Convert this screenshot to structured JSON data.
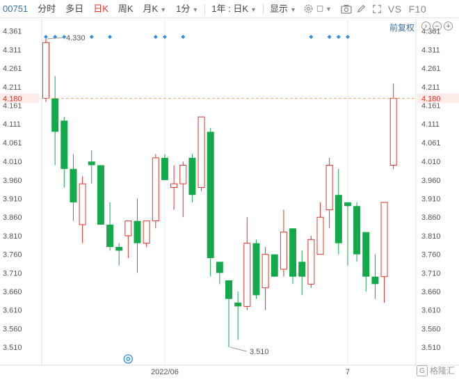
{
  "toolbar": {
    "code": "00751",
    "intraday": "分时",
    "multiday": "多日",
    "daily": "日K",
    "weekly": "周K",
    "monthly": "月K",
    "minute": "1分",
    "range": "1年 : 日K",
    "display": "显示",
    "vs": "VS",
    "f10": "F10"
  },
  "adjust_label": "前复权",
  "watermark": "格隆汇",
  "colors": {
    "up": "#e4322b",
    "down": "#14a94b",
    "up_fill": "#ffffff",
    "price_line": "#e8a66a",
    "price_tag": "#e4322b"
  },
  "chart_data": {
    "type": "candlestick",
    "y_ticks": [
      "4.361",
      "4.311",
      "4.261",
      "4.211",
      "4.161",
      "4.111",
      "4.061",
      "4.010",
      "3.960",
      "3.910",
      "3.860",
      "3.810",
      "3.760",
      "3.710",
      "3.660",
      "3.610",
      "3.560",
      "3.510"
    ],
    "ylim": [
      3.485,
      4.382
    ],
    "x_labels": [
      {
        "index": 13,
        "label": "2022/06"
      },
      {
        "index": 33,
        "label": "7"
      }
    ],
    "current_price": "4.180",
    "max_label": "4.330",
    "max_index": 0,
    "min_label": "3.510",
    "min_index": 18,
    "marker_indices": [
      0,
      1,
      2,
      5,
      7,
      12,
      13,
      15,
      29,
      31,
      32,
      33
    ],
    "candles": [
      {
        "o": 4.18,
        "h": 4.34,
        "l": 4.17,
        "c": 4.33
      },
      {
        "o": 4.18,
        "h": 4.24,
        "l": 4.0,
        "c": 4.09
      },
      {
        "o": 4.12,
        "h": 4.13,
        "l": 3.94,
        "c": 3.99
      },
      {
        "o": 3.99,
        "h": 4.03,
        "l": 3.85,
        "c": 3.9
      },
      {
        "o": 3.84,
        "h": 3.97,
        "l": 3.79,
        "c": 3.95
      },
      {
        "o": 4.01,
        "h": 4.04,
        "l": 3.95,
        "c": 4.0
      },
      {
        "o": 4.0,
        "h": 4.0,
        "l": 3.84,
        "c": 3.84
      },
      {
        "o": 3.84,
        "h": 3.9,
        "l": 3.77,
        "c": 3.78
      },
      {
        "o": 3.78,
        "h": 3.79,
        "l": 3.73,
        "c": 3.77
      },
      {
        "o": 3.81,
        "h": 3.85,
        "l": 3.75,
        "c": 3.85
      },
      {
        "o": 3.85,
        "h": 3.91,
        "l": 3.71,
        "c": 3.79
      },
      {
        "o": 3.79,
        "h": 3.83,
        "l": 3.78,
        "c": 3.85
      },
      {
        "o": 3.85,
        "h": 4.03,
        "l": 3.83,
        "c": 4.02
      },
      {
        "o": 4.02,
        "h": 4.03,
        "l": 3.96,
        "c": 3.96
      },
      {
        "o": 3.94,
        "h": 4.0,
        "l": 3.88,
        "c": 3.95
      },
      {
        "o": 3.95,
        "h": 4.01,
        "l": 3.86,
        "c": 4.0
      },
      {
        "o": 4.02,
        "h": 4.03,
        "l": 3.9,
        "c": 3.92
      },
      {
        "o": 3.94,
        "h": 4.13,
        "l": 3.93,
        "c": 4.13
      },
      {
        "o": 4.09,
        "h": 4.1,
        "l": 3.7,
        "c": 3.75
      },
      {
        "o": 3.74,
        "h": 3.74,
        "l": 3.68,
        "c": 3.71
      },
      {
        "o": 3.69,
        "h": 3.69,
        "l": 3.51,
        "c": 3.64
      },
      {
        "o": 3.63,
        "h": 3.66,
        "l": 3.53,
        "c": 3.62
      },
      {
        "o": 3.62,
        "h": 3.86,
        "l": 3.61,
        "c": 3.79
      },
      {
        "o": 3.79,
        "h": 3.8,
        "l": 3.64,
        "c": 3.65
      },
      {
        "o": 3.67,
        "h": 3.78,
        "l": 3.61,
        "c": 3.76
      },
      {
        "o": 3.76,
        "h": 3.76,
        "l": 3.7,
        "c": 3.7
      },
      {
        "o": 3.72,
        "h": 3.88,
        "l": 3.7,
        "c": 3.82
      },
      {
        "o": 3.83,
        "h": 3.83,
        "l": 3.68,
        "c": 3.7
      },
      {
        "o": 3.74,
        "h": 3.77,
        "l": 3.65,
        "c": 3.7
      },
      {
        "o": 3.68,
        "h": 3.81,
        "l": 3.67,
        "c": 3.8
      },
      {
        "o": 3.76,
        "h": 3.9,
        "l": 3.76,
        "c": 3.86
      },
      {
        "o": 3.88,
        "h": 4.02,
        "l": 3.83,
        "c": 4.0
      },
      {
        "o": 3.92,
        "h": 3.99,
        "l": 3.76,
        "c": 3.79
      },
      {
        "o": 3.9,
        "h": 3.9,
        "l": 3.73,
        "c": 3.89
      },
      {
        "o": 3.89,
        "h": 3.9,
        "l": 3.74,
        "c": 3.76
      },
      {
        "o": 3.82,
        "h": 3.82,
        "l": 3.66,
        "c": 3.7
      },
      {
        "o": 3.7,
        "h": 3.76,
        "l": 3.64,
        "c": 3.68
      },
      {
        "o": 3.7,
        "h": 3.9,
        "l": 3.63,
        "c": 3.9
      },
      {
        "o": 4.0,
        "h": 4.22,
        "l": 3.99,
        "c": 4.18
      }
    ]
  }
}
